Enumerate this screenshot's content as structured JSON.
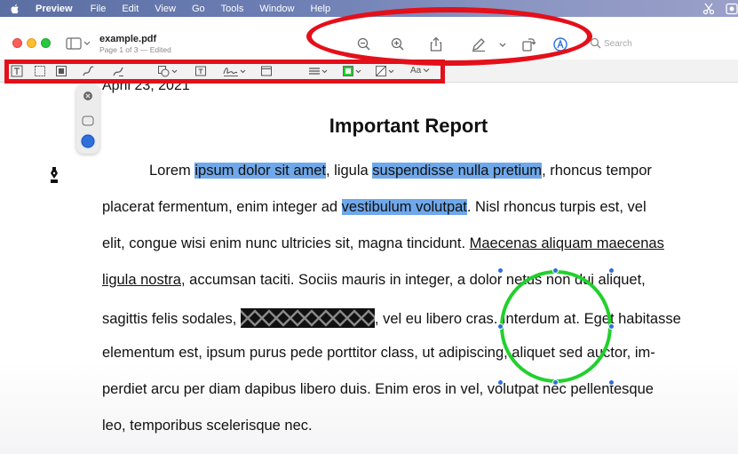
{
  "menubar": {
    "app_name": "Preview",
    "items": [
      "File",
      "Edit",
      "View",
      "Go",
      "Tools",
      "Window",
      "Help"
    ]
  },
  "window": {
    "doc_title": "example.pdf",
    "doc_subtitle": "Page 1 of 3 — Edited"
  },
  "toolbar": {
    "icons": [
      "zoom-out-icon",
      "zoom-in-icon",
      "share-icon",
      "markup-pen-icon",
      "rotate-icon",
      "annotate-icon"
    ],
    "search_placeholder": "Search"
  },
  "markup_toolbar": {
    "tools": [
      "text-selection-icon",
      "rectangular-selection-icon",
      "redact-icon",
      "sketch-icon",
      "draw-icon",
      "shapes-icon",
      "text-box-icon",
      "sign-icon",
      "note-icon",
      "line-style-icon",
      "border-color-icon",
      "fill-color-icon",
      "text-style-icon"
    ],
    "text_style_label": "Aa",
    "accent_colors": {
      "green": "#21d02c",
      "highlight": "#6fa8ea",
      "annotation_red": "#e3101a"
    }
  },
  "document": {
    "date": "April 23, 2021",
    "title": "Important Report",
    "lines": [
      [
        {
          "t": "Lorem "
        },
        {
          "t": "ipsum dolor sit amet",
          "style": "hl"
        },
        {
          "t": ", ligula "
        },
        {
          "t": "suspendisse nulla pretium",
          "style": "hl"
        },
        {
          "t": ", rhoncus tempor"
        }
      ],
      [
        {
          "t": "placerat fermentum, enim integer ad "
        },
        {
          "t": "vestibulum volutpat",
          "style": "hl"
        },
        {
          "t": ". Nisl rhoncus turpis est, vel"
        }
      ],
      [
        {
          "t": "elit, congue wisi enim nunc ultricies sit, magna tincidunt. "
        },
        {
          "t": "Maecenas aliquam maecenas",
          "style": "ul"
        }
      ],
      [
        {
          "t": "ligula nostra",
          "style": "ul"
        },
        {
          "t": ", accumsan taciti. Sociis mauris in integer, a dolor netus non dui aliquet,"
        }
      ],
      [
        {
          "t": "sagittis felis sodales, "
        },
        {
          "t": "",
          "style": "redacted"
        },
        {
          "t": ", vel eu libero cras. Interdum at. Eget habitasse"
        }
      ],
      [
        {
          "t": "elementum est, ipsum purus pede porttitor class, ut adipiscing, aliquet sed auctor, im-"
        }
      ],
      [
        {
          "t": "perdiet arcu per diam dapibus libero duis. Enim eros in vel, volutpat nec pellentesque"
        }
      ],
      [
        {
          "t": "leo, temporibus scelerisque nec."
        }
      ]
    ]
  }
}
